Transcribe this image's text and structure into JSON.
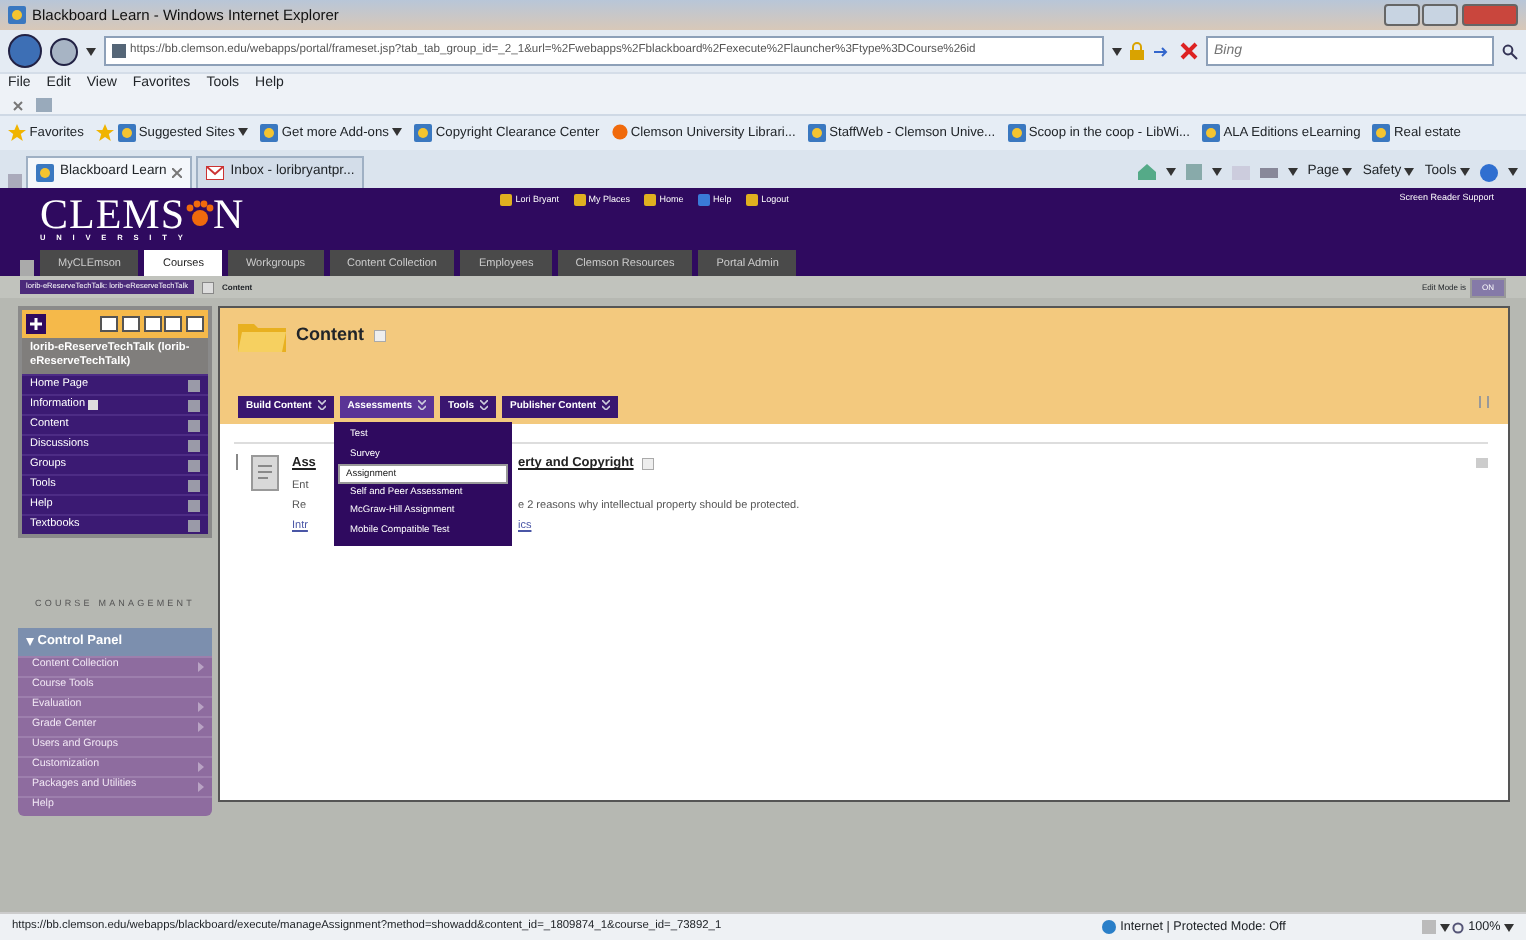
{
  "window": {
    "title": "Blackboard Learn - Windows Internet Explorer"
  },
  "address_bar": {
    "url": "https://bb.clemson.edu/webapps/portal/frameset.jsp?tab_tab_group_id=_2_1&url=%2Fwebapps%2Fblackboard%2Fexecute%2Flauncher%3Ftype%3DCourse%26id",
    "search_placeholder": "Bing"
  },
  "menu_bar": [
    "File",
    "Edit",
    "View",
    "Favorites",
    "Tools",
    "Help"
  ],
  "favorites_bar": [
    {
      "label": "Favorites",
      "has_menu": false
    },
    {
      "label": "Suggested Sites",
      "has_menu": true
    },
    {
      "label": "Get more Add-ons",
      "has_menu": true
    },
    {
      "label": "Copyright Clearance Center",
      "has_menu": false
    },
    {
      "label": "Clemson University Librari...",
      "has_menu": false
    },
    {
      "label": "StaffWeb - Clemson Unive...",
      "has_menu": false
    },
    {
      "label": "Scoop in the coop - LibWi...",
      "has_menu": false
    },
    {
      "label": "ALA Editions eLearning",
      "has_menu": false
    },
    {
      "label": "Real estate",
      "has_menu": false
    }
  ],
  "browser_tabs": [
    {
      "label": "Blackboard Learn",
      "selected": true
    },
    {
      "label": "Inbox - loribryantpr...",
      "selected": false
    }
  ],
  "command_bar": [
    "Page",
    "Safety",
    "Tools"
  ],
  "portal": {
    "logo_left": "CLEMS",
    "logo_right": "N",
    "logo_sub": "UNIVERSITY",
    "user_links": [
      "Lori Bryant",
      "My Places",
      "Home",
      "Help",
      "Logout"
    ],
    "screen_reader": "Screen Reader Support",
    "tabs": [
      {
        "label": "MyCLEmson",
        "selected": false
      },
      {
        "label": "Courses",
        "selected": true
      },
      {
        "label": "Workgroups",
        "selected": false
      },
      {
        "label": "Content Collection",
        "selected": false
      },
      {
        "label": "Employees",
        "selected": false
      },
      {
        "label": "Clemson Resources",
        "selected": false
      },
      {
        "label": "Portal Admin",
        "selected": false
      }
    ]
  },
  "breadcrumb": {
    "course": "lorib-eReserveTechTalk: lorib-eReserveTechTalk",
    "page": "Content"
  },
  "edit_mode": {
    "label": "Edit Mode is",
    "on": true,
    "state_text": "ON"
  },
  "course_menu": {
    "title": "lorib-eReserveTechTalk (lorib-eReserveTechTalk)",
    "items": [
      {
        "label": "Home Page",
        "flag": false
      },
      {
        "label": "Information",
        "flag": true
      },
      {
        "label": "Content",
        "flag": false
      },
      {
        "label": "Discussions",
        "flag": false
      },
      {
        "label": "Groups",
        "flag": false
      },
      {
        "label": "Tools",
        "flag": false
      },
      {
        "label": "Help",
        "flag": false
      },
      {
        "label": "Textbooks",
        "flag": false
      }
    ]
  },
  "course_management": {
    "heading": "COURSE MANAGEMENT",
    "panel_title": "Control Panel",
    "expanded": true,
    "items": [
      {
        "label": "Content Collection",
        "has_submenu": true
      },
      {
        "label": "Course Tools",
        "has_submenu": false
      },
      {
        "label": "Evaluation",
        "has_submenu": true
      },
      {
        "label": "Grade Center",
        "has_submenu": true
      },
      {
        "label": "Users and Groups",
        "has_submenu": false
      },
      {
        "label": "Customization",
        "has_submenu": true
      },
      {
        "label": "Packages and Utilities",
        "has_submenu": true
      },
      {
        "label": "Help",
        "has_submenu": false
      }
    ]
  },
  "content": {
    "title": "Content",
    "action_bar": [
      {
        "label": "Build Content",
        "selected": false
      },
      {
        "label": "Assessments",
        "selected": true
      },
      {
        "label": "Tools",
        "selected": false
      },
      {
        "label": "Publisher Content",
        "selected": false
      }
    ],
    "dropdown": [
      {
        "label": "Test",
        "selected": false
      },
      {
        "label": "Survey",
        "selected": false
      },
      {
        "label": "Assignment",
        "selected": true
      },
      {
        "label": "Self and Peer Assessment",
        "selected": false
      },
      {
        "label": "McGraw-Hill Assignment",
        "selected": false
      },
      {
        "label": "Mobile Compatible Test",
        "selected": false
      }
    ],
    "item": {
      "title_start": "Ass",
      "title_end": "erty and Copyright",
      "line_2": "Ent",
      "line_3_start": "Re",
      "line_3_end": "e 2 reasons why intellectual property should be protected.",
      "link_start": "Intr",
      "link_end": "ics"
    }
  },
  "status_bar": {
    "url": "https://bb.clemson.edu/webapps/blackboard/execute/manageAssignment?method=showadd&content_id=_1809874_1&course_id=_73892_1",
    "zone": "Internet | Protected Mode: Off",
    "zoom": "100%"
  }
}
